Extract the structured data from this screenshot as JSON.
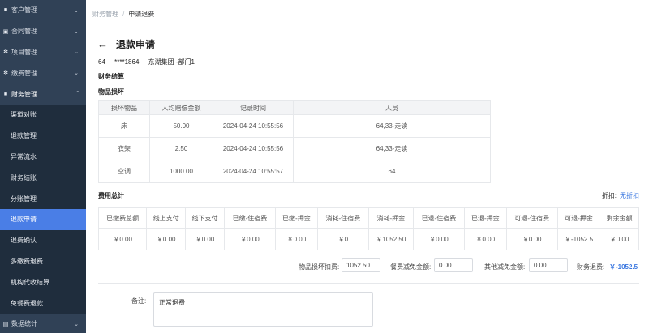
{
  "sidebar": {
    "top_items": [
      {
        "label": "客户管理",
        "icon": "user-icon"
      },
      {
        "label": "合同管理",
        "icon": "folder-icon"
      },
      {
        "label": "项目管理",
        "icon": "gear-icon"
      },
      {
        "label": "缴费管理",
        "icon": "gear-icon"
      }
    ],
    "open_group": {
      "label": "财务管理",
      "icon": "user-icon"
    },
    "sub_items": [
      "渠道对账",
      "退款管理",
      "异常流水",
      "财务结账",
      "分账管理",
      "退款申请",
      "退费确认",
      "多缴费退费",
      "机构代收结算",
      "免餐费退款"
    ],
    "bottom_item": {
      "label": "数据统计",
      "icon": "chart-icon"
    }
  },
  "breadcrumb": {
    "parent": "财务管理",
    "separator": "/",
    "current": "申请退费"
  },
  "header": {
    "title": "退款申请",
    "back_glyph": "←"
  },
  "info": {
    "id": "64",
    "phone": "****1864",
    "org": "东湖集团 -部门1"
  },
  "sections": {
    "finance": "财务结算",
    "damage": "物品损坏",
    "fee_total": "费用总计"
  },
  "damage_table": {
    "headers": [
      "损坏物品",
      "人均赔偿金额",
      "记录时间",
      "人员"
    ],
    "rows": [
      [
        "床",
        "50.00",
        "2024-04-24 10:55:56",
        "64,33-走读"
      ],
      [
        "衣架",
        "2.50",
        "2024-04-24 10:55:56",
        "64,33-走读"
      ],
      [
        "空调",
        "1000.00",
        "2024-04-24 10:55:57",
        "64"
      ]
    ]
  },
  "discount": {
    "label": "折扣:",
    "link": "无折扣"
  },
  "fee_table": {
    "headers": [
      "已缴费总额",
      "线上支付",
      "线下支付",
      "已缴-住宿费",
      "已缴-押金",
      "消耗-住宿费",
      "消耗-押金",
      "已退-住宿费",
      "已退-押金",
      "可退-住宿费",
      "可退-押金",
      "剩余金额"
    ],
    "values": [
      "￥0.00",
      "￥0.00",
      "￥0.00",
      "￥0.00",
      "￥0.00",
      "￥0",
      "￥1052.50",
      "￥0.00",
      "￥0.00",
      "￥0.00",
      "￥-1052.5",
      "￥0.00"
    ]
  },
  "calc": {
    "damage_label": "物品损坏扣费:",
    "damage_value": "1052.50",
    "meal_label": "餐费减免金额:",
    "meal_value": "0.00",
    "other_label": "其他减免金额:",
    "other_value": "0.00",
    "refund_label": "财务退费:",
    "refund_value": "￥-1052.5"
  },
  "remark": {
    "label": "备注:",
    "value": "正常退费"
  }
}
